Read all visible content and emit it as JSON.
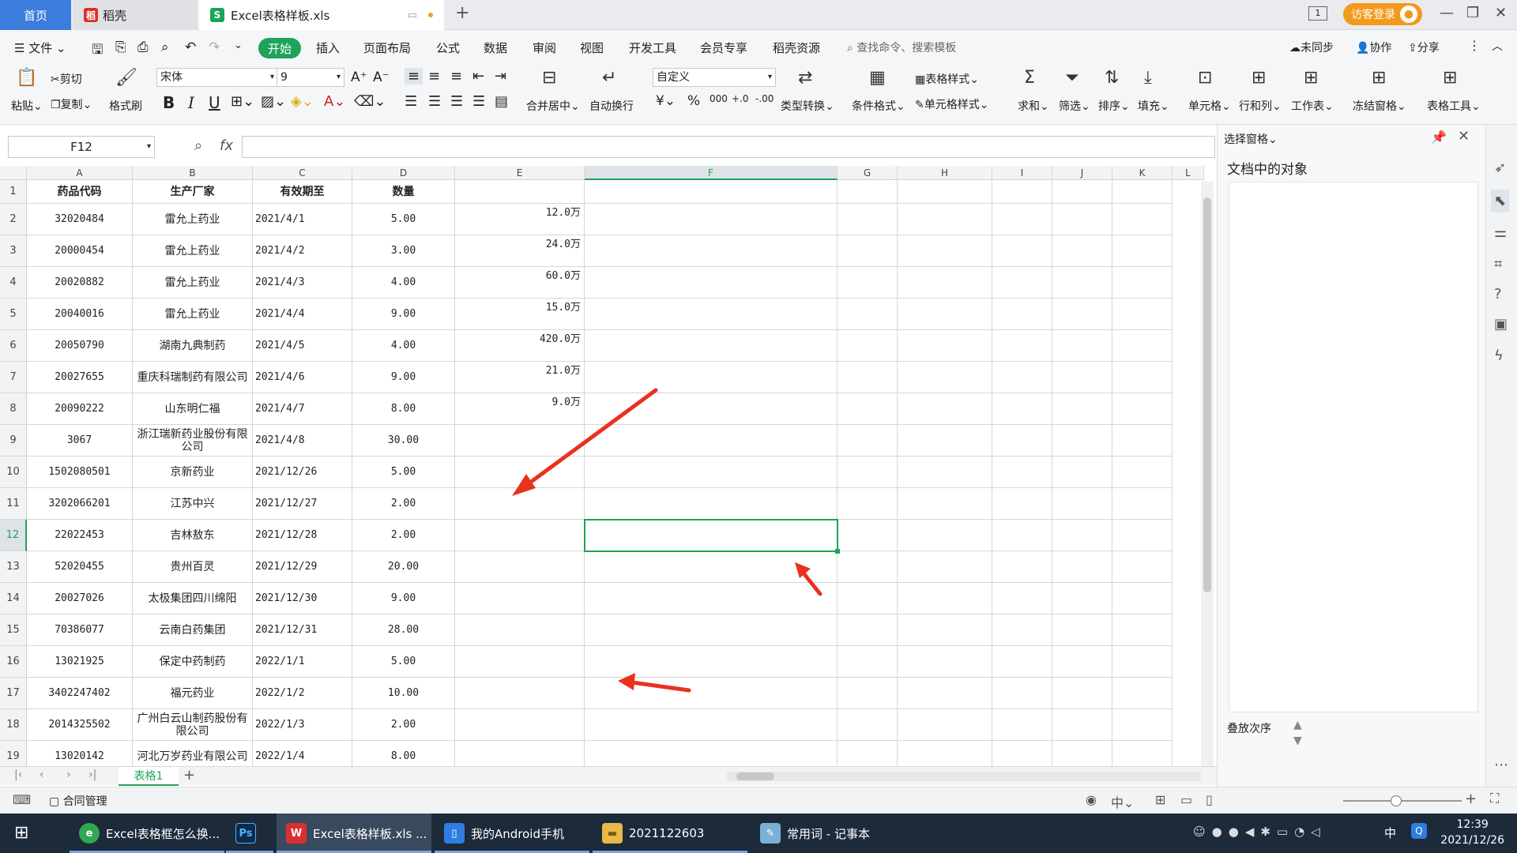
{
  "titlebar": {
    "tabs": [
      {
        "label": "首页"
      },
      {
        "label": "稻壳"
      },
      {
        "label": "Excel表格样板.xls"
      }
    ],
    "login": "访客登录"
  },
  "menu": {
    "file": "文件",
    "items": [
      "开始",
      "插入",
      "页面布局",
      "公式",
      "数据",
      "审阅",
      "视图",
      "开发工具",
      "会员专享",
      "稻壳资源"
    ],
    "search_placeholder": "查找命令、搜索模板",
    "sync": "未同步",
    "collab": "协作",
    "share": "分享"
  },
  "ribbon": {
    "paste": "粘贴",
    "cut": "剪切",
    "copy": "复制",
    "format_painter": "格式刷",
    "font_name": "宋体",
    "font_size": "9",
    "merge_center": "合并居中",
    "wrap": "自动换行",
    "number_format": "自定义",
    "type_convert": "类型转换",
    "cond_format": "条件格式",
    "table_style": "表格样式",
    "cell_style": "单元格样式",
    "sum": "求和",
    "filter": "筛选",
    "sort": "排序",
    "fill": "填充",
    "cell": "单元格",
    "row_col": "行和列",
    "worksheet": "工作表",
    "freeze": "冻结窗格",
    "table_tools": "表格工具"
  },
  "formula": {
    "namebox": "F12",
    "fx": "fx",
    "value": ""
  },
  "sheet": {
    "columns": [
      "A",
      "B",
      "C",
      "D",
      "E",
      "F",
      "G",
      "H",
      "I",
      "J",
      "K",
      "L"
    ],
    "header": [
      "药品代码",
      "生产厂家",
      "有效期至",
      "数量"
    ],
    "rows": [
      [
        "32020484",
        "雷允上药业",
        "2021/4/1",
        "5.00",
        "12.0万"
      ],
      [
        "20000454",
        "雷允上药业",
        "2021/4/2",
        "3.00",
        "24.0万"
      ],
      [
        "20020882",
        "雷允上药业",
        "2021/4/3",
        "4.00",
        "60.0万"
      ],
      [
        "20040016",
        "雷允上药业",
        "2021/4/4",
        "9.00",
        "15.0万"
      ],
      [
        "20050790",
        "湖南九典制药",
        "2021/4/5",
        "4.00",
        "420.0万"
      ],
      [
        "20027655",
        "重庆科瑞制药有限公司",
        "2021/4/6",
        "9.00",
        "21.0万"
      ],
      [
        "20090222",
        "山东明仁福",
        "2021/4/7",
        "8.00",
        "9.0万"
      ],
      [
        "3067",
        "浙江瑞新药业股份有限公司",
        "2021/4/8",
        "30.00",
        ""
      ],
      [
        "1502080501",
        "京新药业",
        "2021/12/26",
        "5.00",
        ""
      ],
      [
        "3202066201",
        "江苏中兴",
        "2021/12/27",
        "2.00",
        ""
      ],
      [
        "22022453",
        "吉林敖东",
        "2021/12/28",
        "2.00",
        ""
      ],
      [
        "52020455",
        "贵州百灵",
        "2021/12/29",
        "20.00",
        ""
      ],
      [
        "20027026",
        "太极集团四川绵阳",
        "2021/12/30",
        "9.00",
        ""
      ],
      [
        "70386077",
        "云南白药集团",
        "2021/12/31",
        "28.00",
        ""
      ],
      [
        "13021925",
        "保定中药制药",
        "2022/1/1",
        "5.00",
        ""
      ],
      [
        "3402247402",
        "福元药业",
        "2022/1/2",
        "10.00",
        ""
      ],
      [
        "2014325502",
        "广州白云山制药股份有限公司",
        "2022/1/3",
        "2.00",
        ""
      ],
      [
        "13020142",
        "河北万岁药业有限公司",
        "2022/1/4",
        "8.00",
        ""
      ]
    ],
    "tab_name": "表格1"
  },
  "side_panel": {
    "title": "选择窗格",
    "subtitle": "文档中的对象",
    "order": "叠放次序"
  },
  "status": {
    "contract": "合同管理"
  },
  "taskbar": {
    "items": [
      {
        "label": "Excel表格框怎么换..."
      },
      {
        "label": ""
      },
      {
        "label": "Excel表格样板.xls ..."
      },
      {
        "label": "我的Android手机"
      },
      {
        "label": "2021122603"
      },
      {
        "label": "常用词 - 记事本"
      }
    ],
    "time": "12:39",
    "date": "2021/12/26",
    "ime": "中"
  },
  "colors": {
    "accent": "#1ea35a",
    "arrow": "#e8321e"
  }
}
